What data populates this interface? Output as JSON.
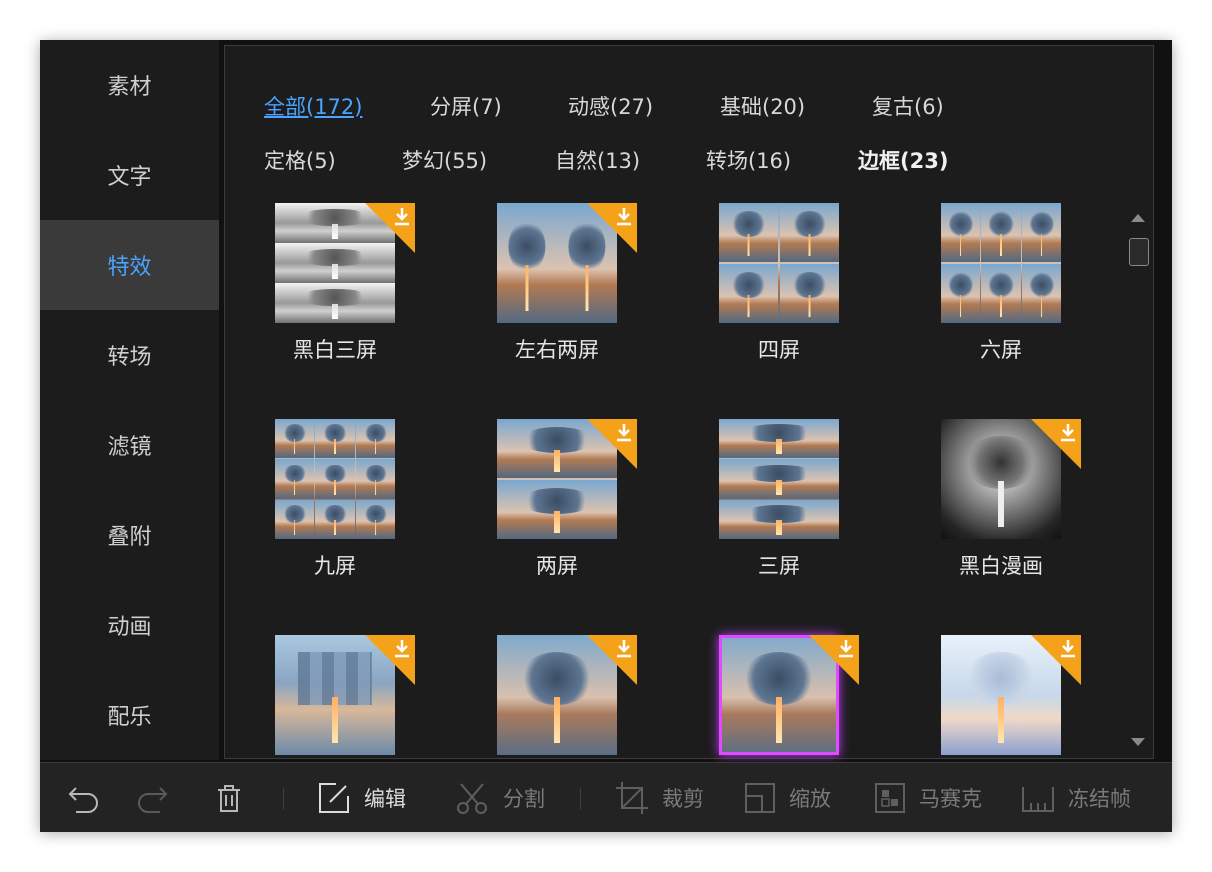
{
  "sidebar": {
    "items": [
      {
        "label": "素材",
        "active": false
      },
      {
        "label": "文字",
        "active": false
      },
      {
        "label": "特效",
        "active": true
      },
      {
        "label": "转场",
        "active": false
      },
      {
        "label": "滤镜",
        "active": false
      },
      {
        "label": "叠附",
        "active": false
      },
      {
        "label": "动画",
        "active": false
      },
      {
        "label": "配乐",
        "active": false
      }
    ]
  },
  "categories": {
    "row1": [
      "全部(172)",
      "分屏(7)",
      "动感(27)",
      "基础(20)",
      "复古(6)"
    ],
    "row2": [
      "定格(5)",
      "梦幻(55)",
      "自然(13)",
      "转场(16)",
      "边框(23)"
    ],
    "active": "全部(172)"
  },
  "effects": [
    {
      "label": "黑白三屏",
      "download": true
    },
    {
      "label": "左右两屏",
      "download": true
    },
    {
      "label": "四屏",
      "download": false
    },
    {
      "label": "六屏",
      "download": false
    },
    {
      "label": "九屏",
      "download": false
    },
    {
      "label": "两屏",
      "download": true
    },
    {
      "label": "三屏",
      "download": false
    },
    {
      "label": "黑白漫画",
      "download": true
    },
    {
      "label": "",
      "download": true
    },
    {
      "label": "",
      "download": true
    },
    {
      "label": "",
      "download": true
    },
    {
      "label": "",
      "download": true
    }
  ],
  "toolbar": {
    "edit": "编辑",
    "split": "分割",
    "crop": "裁剪",
    "scale": "缩放",
    "mosaic": "马赛克",
    "freeze": "冻结帧"
  },
  "colors": {
    "accent": "#4aa3ff",
    "badge": "#f5a21b",
    "background": "#1c1c1c"
  }
}
